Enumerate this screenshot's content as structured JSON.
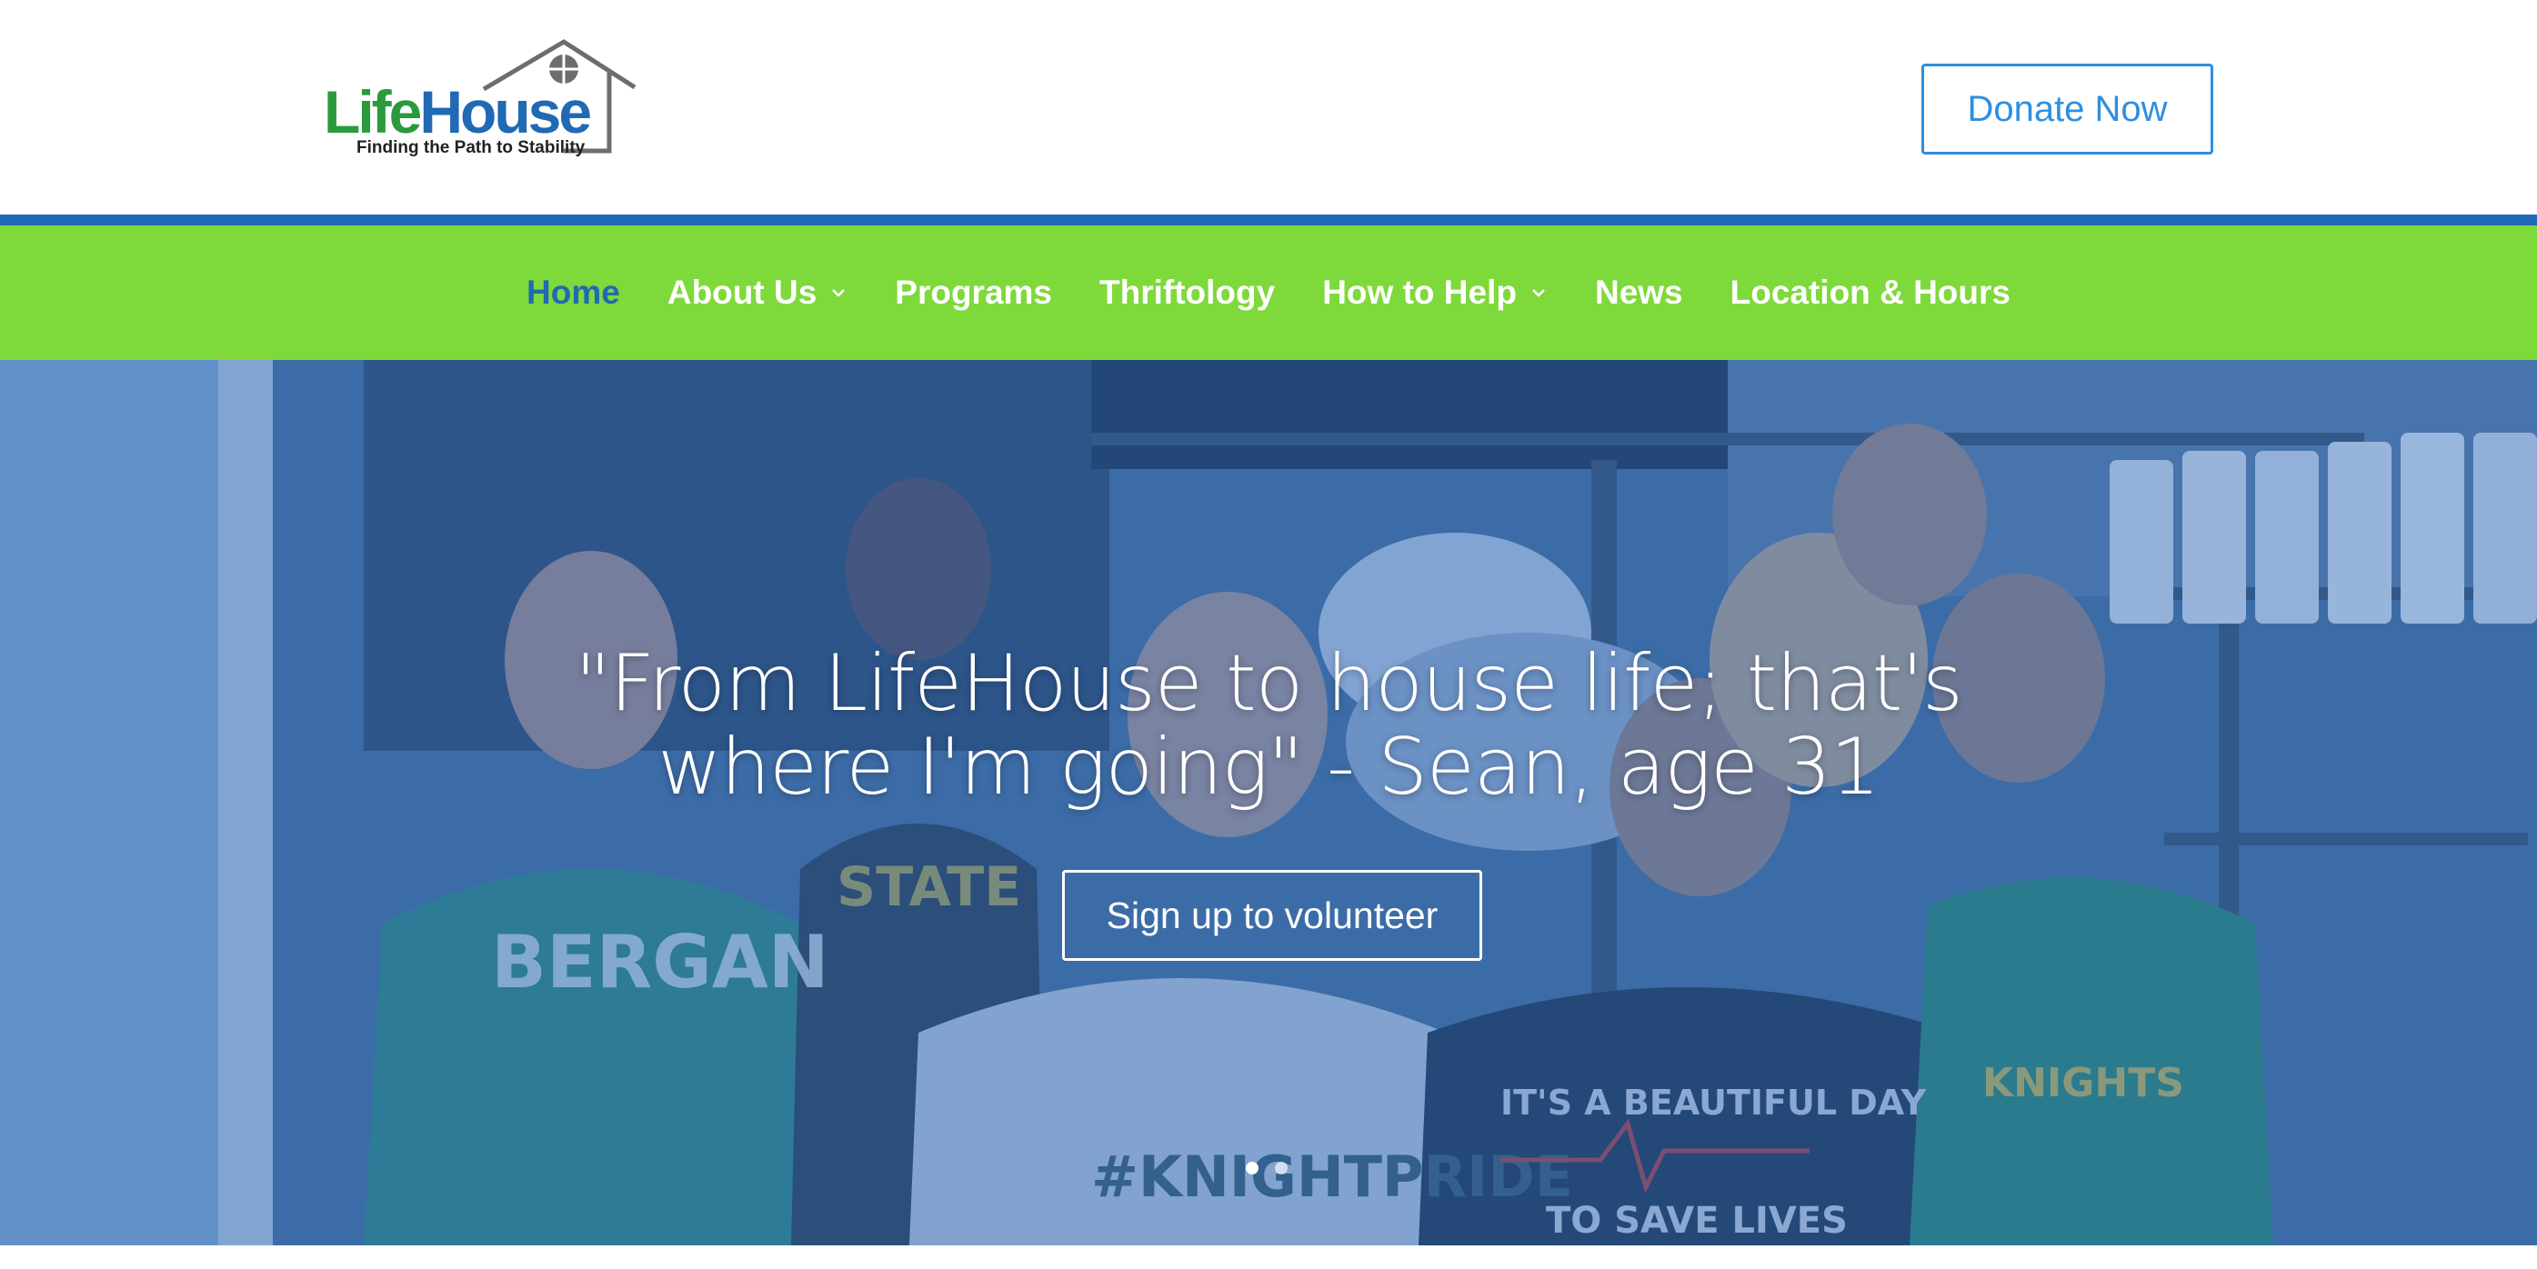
{
  "header": {
    "logo": {
      "word_life": "Life",
      "word_house": "House",
      "tagline": "Finding the Path to Stability"
    },
    "donate_label": "Donate Now"
  },
  "nav": {
    "items": [
      {
        "label": "Home",
        "active": true,
        "dropdown": false
      },
      {
        "label": "About Us",
        "active": false,
        "dropdown": true
      },
      {
        "label": "Programs",
        "active": false,
        "dropdown": false
      },
      {
        "label": "Thriftology",
        "active": false,
        "dropdown": false
      },
      {
        "label": "How to Help",
        "active": false,
        "dropdown": true
      },
      {
        "label": "News",
        "active": false,
        "dropdown": false
      },
      {
        "label": "Location & Hours",
        "active": false,
        "dropdown": false
      }
    ]
  },
  "hero": {
    "quote_line1": "\"From LifeHouse to house life; that's",
    "quote_line2": "where I'm going\" - Sean, age 31",
    "cta_label": "Sign up to volunteer",
    "slides_total": 2,
    "slide_active": 1,
    "photo_shirt_texts": [
      "BERGAN",
      "STATE",
      "#KNIGHTPRIDE",
      "IT'S A BEAUTIFUL DAY",
      "TO SAVE LIVES",
      "KNIGHTS"
    ]
  },
  "colors": {
    "green_brand": "#2a9a3c",
    "blue_brand": "#2069b4",
    "nav_green": "#7ed93a",
    "donate_blue": "#2e8fe0",
    "hero_overlay": "#2d69b9"
  }
}
